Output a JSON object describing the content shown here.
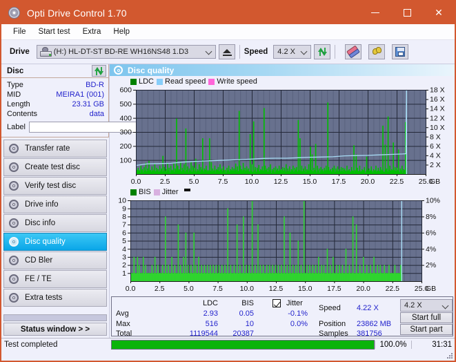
{
  "window": {
    "title": "Opti Drive Control 1.70",
    "icon": "disc-icon",
    "minimize": "minimize-icon",
    "maximize": "maximize-icon",
    "close": "close-icon",
    "accent_color": "#d2582f"
  },
  "menu": {
    "items": [
      "File",
      "Start test",
      "Extra",
      "Help"
    ]
  },
  "toolbar": {
    "drive_label": "Drive",
    "drive_value": "(H:)  HL-DT-ST BD-RE  WH16NS48 1.D3",
    "eject_icon": "eject-icon",
    "speed_label": "Speed",
    "speed_value": "4.2 X",
    "refresh_icon": "refresh-icon",
    "erase_icon": "eraser-icon",
    "tools_icon": "hand-tools-icon",
    "save_icon": "floppy-save-icon"
  },
  "disc": {
    "panel_title": "Disc",
    "refresh_icon": "refresh-icon",
    "rows": [
      {
        "key": "Type",
        "value": "BD-R"
      },
      {
        "key": "MID",
        "value": "MEIRA1 (001)"
      },
      {
        "key": "Length",
        "value": "23.31 GB"
      },
      {
        "key": "Contents",
        "value": "data"
      }
    ],
    "label_key": "Label",
    "label_value": "",
    "label_placeholder": "",
    "disc_button_icon": "cd-disc-icon"
  },
  "sidebar": {
    "items": [
      {
        "label": "Transfer rate",
        "icon": "disc-icon",
        "selected": false
      },
      {
        "label": "Create test disc",
        "icon": "disc-icon",
        "selected": false
      },
      {
        "label": "Verify test disc",
        "icon": "disc-icon",
        "selected": false
      },
      {
        "label": "Drive info",
        "icon": "disc-icon",
        "selected": false
      },
      {
        "label": "Disc info",
        "icon": "disc-icon",
        "selected": false
      },
      {
        "label": "Disc quality",
        "icon": "disc-icon",
        "selected": true
      },
      {
        "label": "CD Bler",
        "icon": "disc-icon",
        "selected": false
      },
      {
        "label": "FE / TE",
        "icon": "disc-icon",
        "selected": false
      },
      {
        "label": "Extra tests",
        "icon": "disc-icon",
        "selected": false
      }
    ],
    "status_window_button": "Status window > >"
  },
  "main": {
    "title": "Disc quality",
    "icon": "disc-quality-icon"
  },
  "stats": {
    "col_headers": [
      "LDC",
      "BIS"
    ],
    "jitter_label": "Jitter",
    "jitter_checked": true,
    "rows": [
      {
        "label": "Avg",
        "ldc": "2.93",
        "bis": "0.05",
        "jitter": "-0.1%"
      },
      {
        "label": "Max",
        "ldc": "516",
        "bis": "10",
        "jitter": "0.0%"
      },
      {
        "label": "Total",
        "ldc": "1119544",
        "bis": "20387",
        "jitter": ""
      }
    ],
    "speed_label": "Speed",
    "speed_value": "4.22 X",
    "position_label": "Position",
    "position_value": "23862 MB",
    "samples_label": "Samples",
    "samples_value": "381756",
    "speed_select": "4.2 X",
    "start_full": "Start full",
    "start_part": "Start part"
  },
  "status": {
    "text": "Test completed",
    "progress_percent": "100.0%",
    "progress_value": 100,
    "elapsed": "31:31"
  },
  "chart_data": [
    {
      "id": "ldc-chart",
      "type": "bar",
      "title": "",
      "legend": [
        {
          "label": "LDC",
          "color": "#008000"
        },
        {
          "label": "Read speed",
          "color": "#87cefa"
        },
        {
          "label": "Write speed",
          "color": "#ff66d9"
        }
      ],
      "legend_position": "top-left",
      "xlabel": "GB",
      "ylabel": "",
      "xlim": [
        0,
        25
      ],
      "xticks": [
        "0.0",
        "2.5",
        "5.0",
        "7.5",
        "10.0",
        "12.5",
        "15.0",
        "17.5",
        "20.0",
        "22.5",
        "25.0"
      ],
      "ylim": [
        0,
        600
      ],
      "yticks": [
        100,
        200,
        300,
        400,
        500,
        600
      ],
      "y2label": "X",
      "y2lim": [
        0,
        18
      ],
      "y2ticks": [
        "2 X",
        "4 X",
        "6 X",
        "8 X",
        "10 X",
        "12 X",
        "14 X",
        "16 X",
        "18 X"
      ],
      "grid": true,
      "series": [
        {
          "name": "LDC",
          "color": "#00c000",
          "x": [
            0.05,
            0.18,
            0.3,
            0.42,
            0.55,
            0.7,
            0.85,
            1.0,
            1.12,
            1.25,
            1.38,
            1.5,
            1.62,
            1.78,
            1.9,
            2.05,
            2.2,
            2.32,
            2.45,
            2.6,
            2.72,
            2.85,
            3.0,
            3.12,
            3.25,
            3.38,
            3.5,
            3.6,
            3.72,
            3.85,
            4.0,
            4.15,
            4.3,
            4.45,
            4.6,
            4.75,
            4.9,
            5.0,
            5.15,
            5.3,
            5.45,
            5.6,
            5.75,
            5.9,
            6.05,
            6.2,
            6.35,
            6.5,
            6.62,
            6.8,
            6.95,
            7.1,
            7.25,
            7.4,
            7.55,
            7.7,
            7.85,
            8.0,
            8.15,
            8.3,
            8.45,
            8.6,
            8.75,
            8.9,
            9.0,
            9.1,
            9.25,
            9.4,
            9.55,
            9.7,
            9.85,
            10.0,
            10.15,
            10.3,
            10.45,
            10.6,
            10.75,
            10.9,
            11.05,
            11.15,
            11.3,
            11.45,
            11.6,
            11.75,
            11.9,
            12.05,
            12.2,
            12.35,
            12.5,
            12.65,
            12.8,
            12.95,
            13.1,
            13.25,
            13.4,
            13.55,
            13.7,
            13.85,
            14.0,
            14.15,
            14.3,
            14.45,
            14.6,
            14.75,
            14.9,
            15.05,
            15.2,
            15.35,
            15.5,
            15.65,
            15.8,
            15.95,
            16.1,
            16.25,
            16.4,
            16.55,
            16.62,
            16.8,
            16.95,
            17.1,
            17.25,
            17.4,
            17.55,
            17.7,
            17.85,
            18.0,
            18.2,
            18.4,
            18.6,
            18.8,
            19.0,
            19.1,
            19.3,
            19.5,
            19.7,
            19.9,
            20.1,
            20.3,
            20.5,
            20.7,
            20.9,
            21.1,
            21.3,
            21.5,
            21.62,
            21.75,
            21.9,
            22.05,
            22.2,
            22.35,
            22.5,
            22.65,
            22.8,
            22.95,
            23.1,
            23.25,
            23.35
          ],
          "y": [
            30,
            45,
            28,
            60,
            35,
            50,
            80,
            40,
            95,
            30,
            55,
            25,
            70,
            45,
            35,
            60,
            40,
            130,
            50,
            35,
            80,
            45,
            60,
            30,
            75,
            40,
            395,
            60,
            35,
            90,
            45,
            70,
            325,
            55,
            40,
            85,
            60,
            45,
            110,
            35,
            70,
            50,
            255,
            40,
            60,
            30,
            255,
            85,
            40,
            60,
            35,
            50,
            70,
            40,
            55,
            30,
            45,
            60,
            35,
            50,
            40,
            75,
            55,
            450,
            60,
            35,
            80,
            45,
            55,
            40,
            285,
            70,
            375,
            50,
            45,
            65,
            35,
            55,
            470,
            60,
            40,
            50,
            70,
            35,
            45,
            55,
            40,
            60,
            35,
            50,
            45,
            70,
            40,
            55,
            35,
            60,
            45,
            50,
            385,
            255,
            60,
            40,
            55,
            35,
            70,
            195,
            140,
            45,
            215,
            60,
            40,
            50,
            35,
            45,
            60,
            510,
            50,
            35,
            45,
            60,
            40,
            55,
            35,
            50,
            45,
            40,
            60,
            35,
            50,
            205,
            140,
            45,
            60,
            35,
            50,
            125,
            40,
            55,
            35,
            60,
            45,
            50,
            345,
            210,
            40,
            410,
            60,
            35,
            225,
            50,
            45,
            175,
            40,
            60,
            35,
            370,
            45
          ]
        },
        {
          "name": "Read speed",
          "color": "#a8dcf5",
          "type": "line",
          "x": [
            0.0,
            1.0,
            2.0,
            3.0,
            4.0,
            5.0,
            6.0,
            7.0,
            8.0,
            9.0,
            10.0,
            11.0,
            12.0,
            13.0,
            14.0,
            15.0,
            16.0,
            17.0,
            18.0,
            19.0,
            20.0,
            21.0,
            22.0,
            23.0,
            23.3,
            23.32,
            23.35
          ],
          "y_x_units": [
            1.85,
            2.2,
            2.25,
            2.3,
            2.55,
            2.7,
            2.8,
            2.9,
            3.0,
            3.1,
            3.2,
            3.35,
            3.4,
            3.4,
            3.5,
            3.6,
            3.65,
            3.7,
            3.9,
            3.95,
            4.0,
            4.1,
            4.2,
            4.3,
            4.35,
            12.0,
            18.0
          ]
        }
      ]
    },
    {
      "id": "bis-chart",
      "type": "bar",
      "title": "",
      "legend": [
        {
          "label": "BIS",
          "color": "#008000"
        },
        {
          "label": "Jitter",
          "color": "#d8b0e0"
        }
      ],
      "legend_position": "top-left",
      "xlabel": "GB",
      "ylabel": "",
      "xlim": [
        0,
        25
      ],
      "xticks": [
        "0.0",
        "2.5",
        "5.0",
        "7.5",
        "10.0",
        "12.5",
        "15.0",
        "17.5",
        "20.0",
        "22.5",
        "25.0"
      ],
      "ylim": [
        0,
        10
      ],
      "yticks": [
        1,
        2,
        3,
        4,
        5,
        6,
        7,
        8,
        9,
        10
      ],
      "y2label": "%",
      "y2lim": [
        0,
        10
      ],
      "y2ticks": [
        "2%",
        "4%",
        "6%",
        "8%",
        "10%"
      ],
      "grid": true,
      "series": [
        {
          "name": "BIS",
          "color": "#2fd42f",
          "baseline": 1,
          "x": [
            0.3,
            0.6,
            0.75,
            0.95,
            1.1,
            1.3,
            1.55,
            1.85,
            2.1,
            2.35,
            2.5,
            2.75,
            3.0,
            3.25,
            3.55,
            3.8,
            4.1,
            4.3,
            4.55,
            4.75,
            4.95,
            5.2,
            5.45,
            5.6,
            5.85,
            6.1,
            6.35,
            6.6,
            6.85,
            7.1,
            7.35,
            7.6,
            7.85,
            8.1,
            8.35,
            8.6,
            8.9,
            9.15,
            9.4,
            9.7,
            9.95,
            10.2,
            10.45,
            10.7,
            10.95,
            11.15,
            11.4,
            11.7,
            11.95,
            12.2,
            12.45,
            12.7,
            12.95,
            13.2,
            13.45,
            13.7,
            13.95,
            14.2,
            14.4,
            14.65,
            14.9,
            15.15,
            15.4,
            15.65,
            15.9,
            16.15,
            16.4,
            16.6,
            16.9,
            17.15,
            17.4,
            17.7,
            17.95,
            18.2,
            18.5,
            18.8,
            19.1,
            19.4,
            19.7,
            20.0,
            20.3,
            20.6,
            20.9,
            21.2,
            21.45,
            21.6,
            21.8,
            22.0,
            22.2,
            22.45,
            22.7,
            22.95,
            23.2,
            23.3
          ],
          "y": [
            3,
            3,
            2,
            1,
            3,
            2,
            1,
            2,
            3,
            2,
            1,
            2,
            8,
            2,
            3,
            2,
            7,
            2,
            3,
            6,
            2,
            2,
            6,
            2,
            3,
            2,
            2,
            2,
            2,
            2,
            2,
            2,
            2,
            2,
            9,
            2,
            2,
            7,
            2,
            8,
            2,
            2,
            10,
            2,
            7,
            2,
            2,
            2,
            2,
            2,
            2,
            2,
            2,
            8,
            2,
            6,
            2,
            2,
            5,
            2,
            10,
            2,
            2,
            2,
            2,
            3,
            2,
            2,
            4,
            2,
            3,
            2,
            2,
            2,
            4,
            2,
            8,
            7,
            2,
            3,
            2,
            2,
            3,
            2,
            2,
            1,
            2,
            1,
            2,
            1,
            2,
            1,
            2,
            1
          ]
        }
      ]
    }
  ]
}
